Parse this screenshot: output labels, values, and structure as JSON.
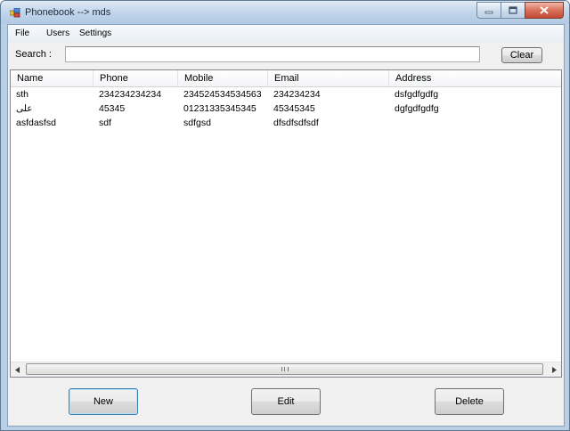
{
  "window": {
    "title": "Phonebook --> mds"
  },
  "menu": {
    "items": [
      "File",
      "Users",
      "Settings"
    ]
  },
  "search": {
    "label": "Search :",
    "value": "",
    "placeholder": ""
  },
  "buttons": {
    "clear": "Clear",
    "new": "New",
    "edit": "Edit",
    "delete": "Delete"
  },
  "table": {
    "columns": [
      "Name",
      "Phone",
      "Mobile",
      "Email",
      "Address"
    ],
    "rows": [
      [
        "sth",
        "234234234234",
        "234524534534563",
        "234234234",
        "dsfgdfgdfg"
      ],
      [
        "علی",
        "45345",
        "01231335345345",
        "45345345",
        "dgfgdfgdfg"
      ],
      [
        "asfdasfsd",
        "sdf",
        "sdfgsd",
        "dfsdfsdfsdf",
        ""
      ]
    ]
  },
  "scrollbar": {
    "thumb_fraction": 1.0
  },
  "icons": {
    "app": "phonebook-icon",
    "minimize": "minimize-icon",
    "maximize": "maximize-icon",
    "close": "close-icon",
    "scroll_left": "arrow-left-icon",
    "scroll_right": "arrow-right-icon"
  },
  "colors": {
    "titlebar": "#bfd3ea",
    "close_button": "#d9705a",
    "default_button_border": "#3c7fb1"
  }
}
